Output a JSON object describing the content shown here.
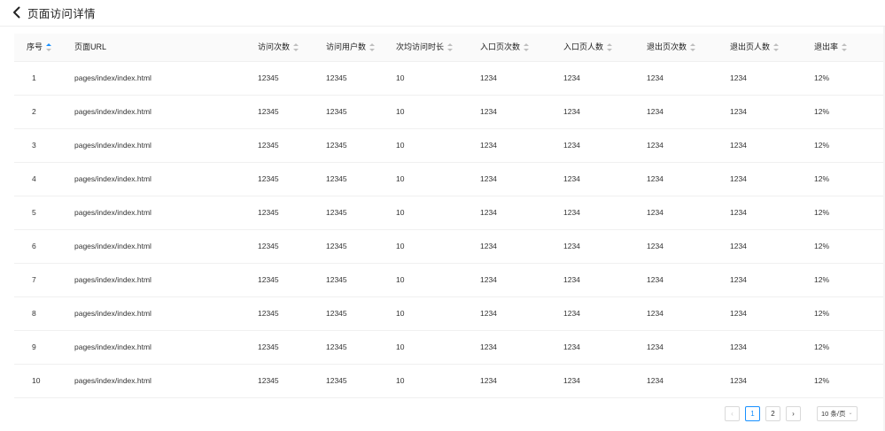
{
  "header": {
    "title": "页面访问详情"
  },
  "table": {
    "columns": [
      {
        "label": "序号",
        "sortable": true,
        "active": true
      },
      {
        "label": "页面URL",
        "sortable": false
      },
      {
        "label": "访问次数",
        "sortable": true
      },
      {
        "label": "访问用户数",
        "sortable": true
      },
      {
        "label": "次均访问时长",
        "sortable": true
      },
      {
        "label": "入口页次数",
        "sortable": true
      },
      {
        "label": "入口页人数",
        "sortable": true
      },
      {
        "label": "退出页次数",
        "sortable": true
      },
      {
        "label": "退出页人数",
        "sortable": true
      },
      {
        "label": "退出率",
        "sortable": true
      }
    ],
    "rows": [
      [
        "1",
        "pages/index/index.html",
        "12345",
        "12345",
        "10",
        "1234",
        "1234",
        "1234",
        "1234",
        "12%"
      ],
      [
        "2",
        "pages/index/index.html",
        "12345",
        "12345",
        "10",
        "1234",
        "1234",
        "1234",
        "1234",
        "12%"
      ],
      [
        "3",
        "pages/index/index.html",
        "12345",
        "12345",
        "10",
        "1234",
        "1234",
        "1234",
        "1234",
        "12%"
      ],
      [
        "4",
        "pages/index/index.html",
        "12345",
        "12345",
        "10",
        "1234",
        "1234",
        "1234",
        "1234",
        "12%"
      ],
      [
        "5",
        "pages/index/index.html",
        "12345",
        "12345",
        "10",
        "1234",
        "1234",
        "1234",
        "1234",
        "12%"
      ],
      [
        "6",
        "pages/index/index.html",
        "12345",
        "12345",
        "10",
        "1234",
        "1234",
        "1234",
        "1234",
        "12%"
      ],
      [
        "7",
        "pages/index/index.html",
        "12345",
        "12345",
        "10",
        "1234",
        "1234",
        "1234",
        "1234",
        "12%"
      ],
      [
        "8",
        "pages/index/index.html",
        "12345",
        "12345",
        "10",
        "1234",
        "1234",
        "1234",
        "1234",
        "12%"
      ],
      [
        "9",
        "pages/index/index.html",
        "12345",
        "12345",
        "10",
        "1234",
        "1234",
        "1234",
        "1234",
        "12%"
      ],
      [
        "10",
        "pages/index/index.html",
        "12345",
        "12345",
        "10",
        "1234",
        "1234",
        "1234",
        "1234",
        "12%"
      ]
    ]
  },
  "pagination": {
    "prev": "‹",
    "pages": [
      "1",
      "2"
    ],
    "current": "1",
    "next": "›",
    "page_size": "10 条/页"
  },
  "colors": {
    "accent": "#1890ff",
    "header_bg": "#fafafa",
    "border": "#f0f0f0"
  }
}
